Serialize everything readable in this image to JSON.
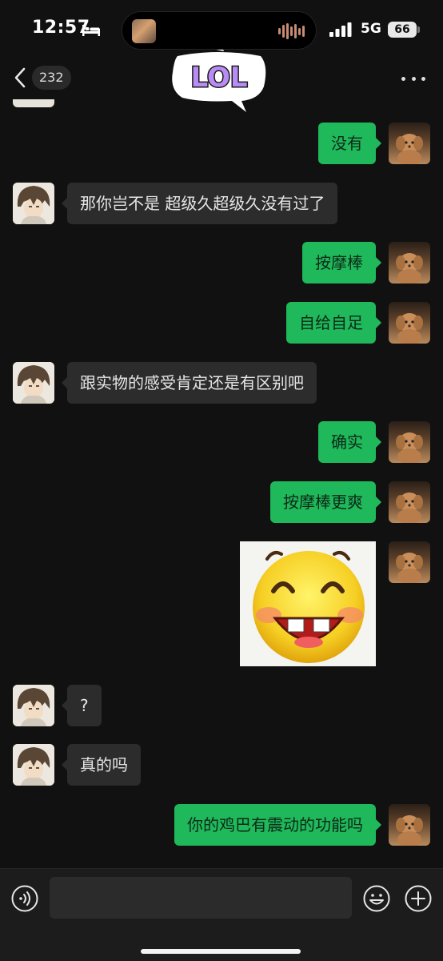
{
  "status_bar": {
    "time": "12:57",
    "network": "5G",
    "battery": "66",
    "icons": [
      "bed-icon",
      "signal-icon"
    ]
  },
  "nav": {
    "unread_count": "232",
    "back_icon": "chevron-left-icon",
    "more_icon": "more-dots-icon"
  },
  "sticker_top": {
    "text": "LOL",
    "color_fill": "#b98cf5",
    "color_outline": "#1a1a1a"
  },
  "messages": [
    {
      "side": "out",
      "text": "没有"
    },
    {
      "side": "in",
      "text": "那你岂不是 超级久超级久没有过了"
    },
    {
      "side": "out",
      "text": "按摩棒"
    },
    {
      "side": "out",
      "text": "自给自足"
    },
    {
      "side": "in",
      "text": "跟实物的感受肯定还是有区别吧"
    },
    {
      "side": "out",
      "text": "确实"
    },
    {
      "side": "out",
      "text": "按摩棒更爽"
    },
    {
      "side": "out",
      "type": "sticker",
      "sticker": "grinning-emoji-face"
    },
    {
      "side": "in",
      "text": "?"
    },
    {
      "side": "in",
      "text": "真的吗"
    },
    {
      "side": "out",
      "text": "你的鸡巴有震动的功能吗"
    }
  ],
  "input_bar": {
    "placeholder": "",
    "icons": [
      "voice-icon",
      "emoji-icon",
      "plus-icon"
    ]
  },
  "colors": {
    "background": "#111111",
    "incoming_bubble": "#2c2c2c",
    "outgoing_bubble": "#1fb85a"
  }
}
